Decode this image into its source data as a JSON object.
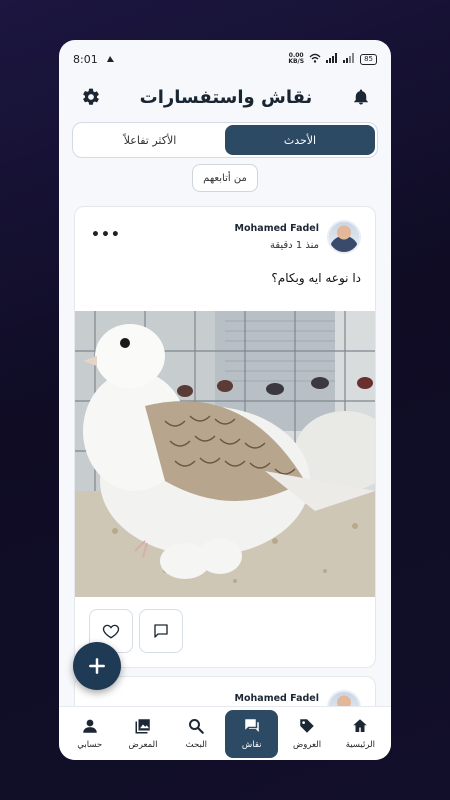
{
  "status": {
    "time": "8:01",
    "speed_value": "0.00",
    "speed_unit": "KB/S",
    "battery": "85"
  },
  "header": {
    "title": "نقاش واستفسارات",
    "settings_icon": "gear-icon",
    "notifications_icon": "bell-icon"
  },
  "tabs": {
    "latest": "الأحدث",
    "most_interactive": "الأكثر تفاعلاً",
    "active": "latest"
  },
  "filter": {
    "following": "من أتابعهم"
  },
  "posts": [
    {
      "author": "Mohamed Fadel",
      "time": "منذ 1 دقيقة",
      "text": "دا نوعه ايه وبكام؟"
    },
    {
      "author": "Mohamed Fadel"
    }
  ],
  "actions": {
    "like_icon": "heart-icon",
    "comment_icon": "comment-icon",
    "more_icon": "more-dots-icon",
    "fab_icon": "plus-icon"
  },
  "nav": [
    {
      "label": "الرئيسية",
      "icon": "home-icon"
    },
    {
      "label": "العروض",
      "icon": "tag-icon"
    },
    {
      "label": "نقاش",
      "icon": "chat-icon",
      "active": true
    },
    {
      "label": "البحث",
      "icon": "search-icon"
    },
    {
      "label": "المعرض",
      "icon": "gallery-icon"
    },
    {
      "label": "حسابي",
      "icon": "person-icon"
    }
  ],
  "colors": {
    "primary": "#2d4a65",
    "fab": "#1f3a55",
    "background": "#f6f8fb"
  }
}
